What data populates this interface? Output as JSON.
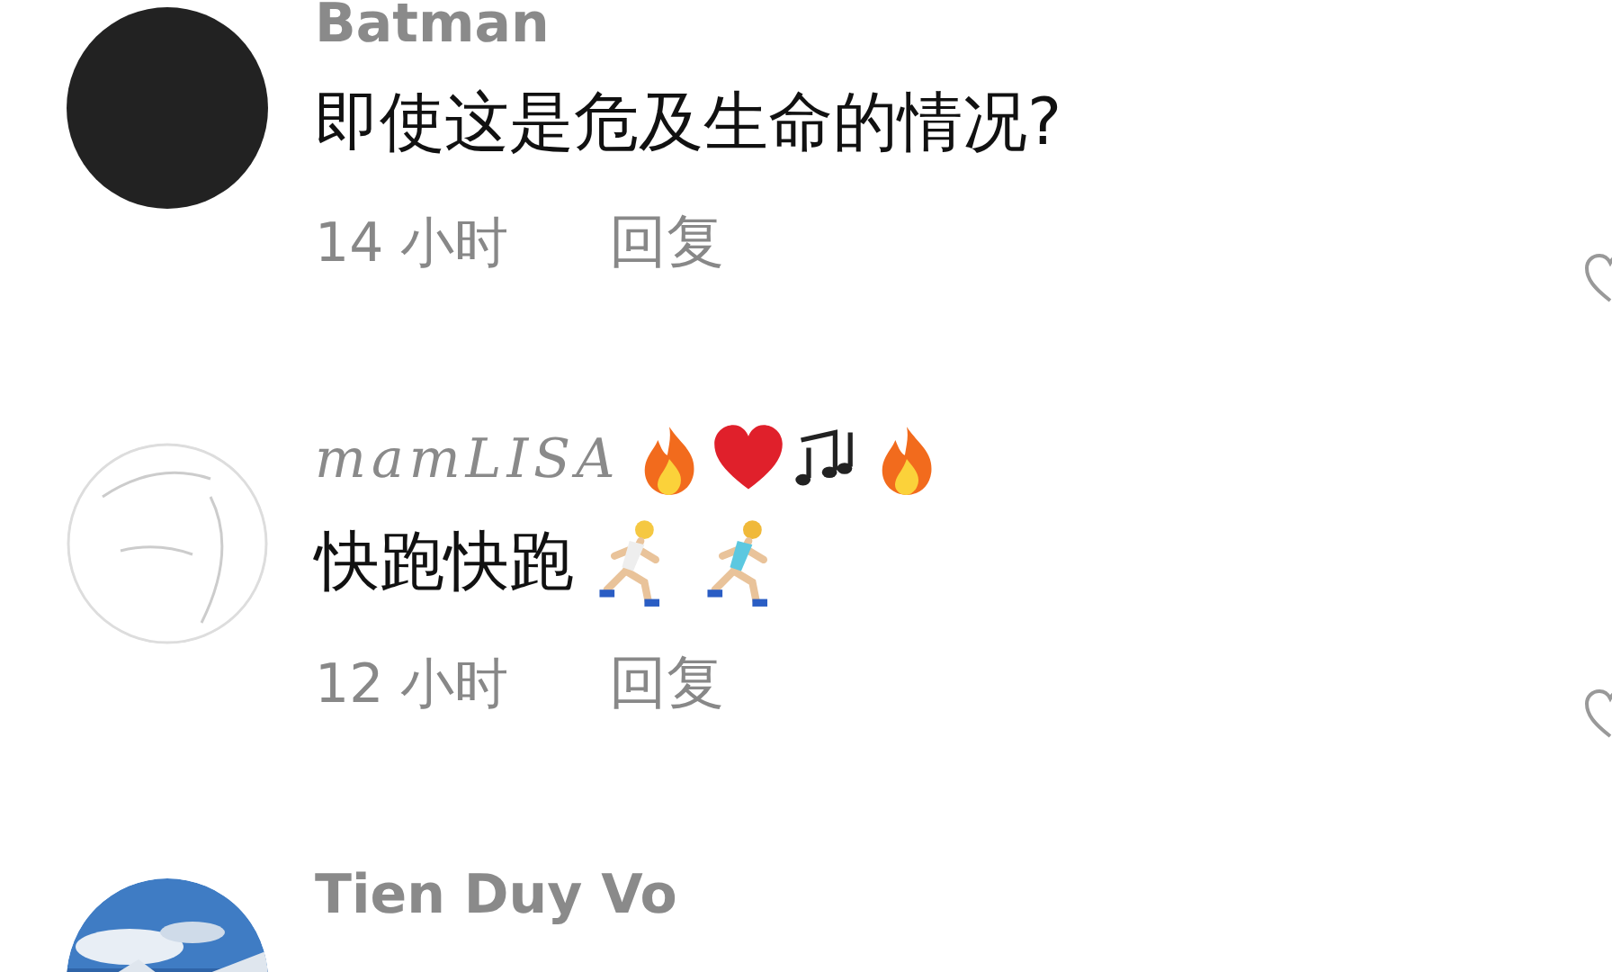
{
  "comments": [
    {
      "author": "Batman",
      "kind": "plain",
      "text": "即使这是危及生命的情况?",
      "time": "14 小时",
      "reply": "回复"
    },
    {
      "author": "mamLISA",
      "kind": "emoji",
      "text": "快跑快跑",
      "time": "12 小时",
      "reply": "回复"
    },
    {
      "author": "Tien Duy Vo"
    }
  ]
}
